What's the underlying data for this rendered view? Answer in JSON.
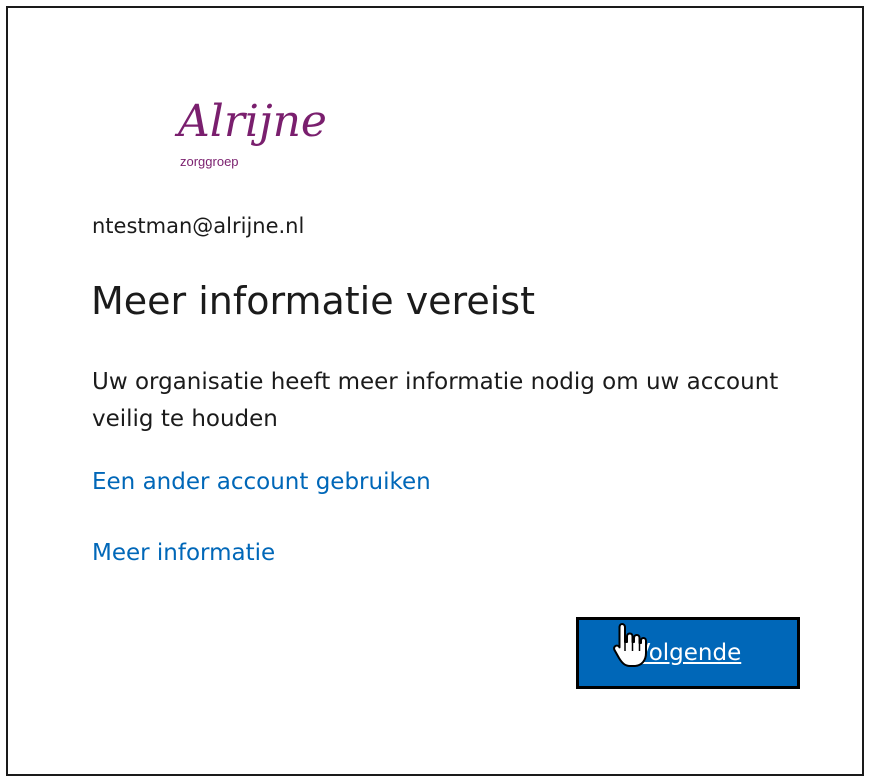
{
  "logo": {
    "name": "Alrijne",
    "subtitle": "zorggroep",
    "color": "#7a1f6e"
  },
  "account": {
    "email": "ntestman@alrijne.nl"
  },
  "main": {
    "title": "Meer informatie vereist",
    "description": "Uw organisatie heeft meer informatie nodig om uw account veilig te houden",
    "links": {
      "other_account": "Een ander account gebruiken",
      "more_info": "Meer informatie"
    },
    "next_button": "Volgende"
  },
  "colors": {
    "link": "#0067b8",
    "button_bg": "#0067b8",
    "text": "#1b1b1b"
  },
  "icons": {
    "cursor": "hand-pointer-icon"
  }
}
